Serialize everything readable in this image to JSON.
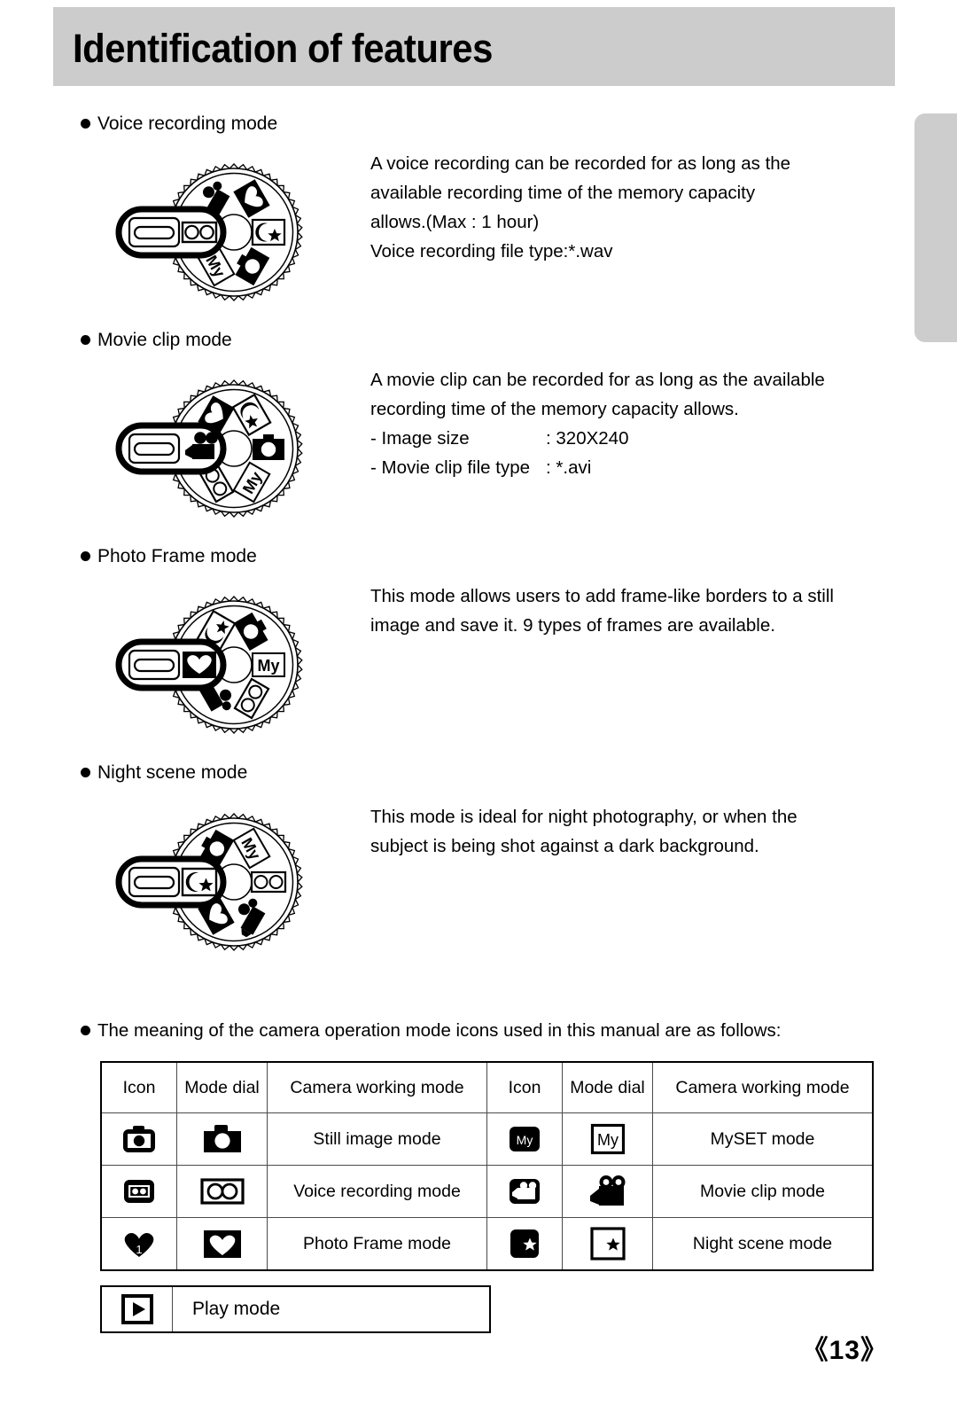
{
  "header": {
    "title": "Identification of features"
  },
  "sections": [
    {
      "heading": "Voice recording mode",
      "body_lines": [
        "A voice recording can be recorded for as long as the",
        "available recording time of the memory capacity",
        "allows.(Max : 1 hour)",
        "Voice recording file type:*.wav"
      ],
      "specs": []
    },
    {
      "heading": "Movie clip mode",
      "body_lines": [
        "A movie clip can be recorded for as long as the available",
        "recording time of the memory capacity allows."
      ],
      "specs": [
        {
          "key": "- Image size",
          "value": ": 320X240"
        },
        {
          "key": "- Movie clip file type",
          "value": ": *.avi"
        }
      ]
    },
    {
      "heading": "Photo Frame mode",
      "body_lines": [
        "This mode allows users to add frame-like borders to a still",
        "image and save it. 9 types of frames are available."
      ],
      "specs": []
    },
    {
      "heading": "Night scene mode",
      "body_lines": [
        "This mode is ideal for night photography, or when the",
        "subject is being shot against a dark background."
      ],
      "specs": []
    }
  ],
  "legend": {
    "intro": "The meaning of the camera operation mode icons used in this manual are as follows:",
    "headers": [
      "Icon",
      "Mode dial",
      "Camera working mode",
      "Icon",
      "Mode dial",
      "Camera working mode"
    ],
    "rows": [
      {
        "left_mode": "Still image mode",
        "right_mode": "MySET mode"
      },
      {
        "left_mode": "Voice recording mode",
        "right_mode": "Movie clip mode"
      },
      {
        "left_mode": "Photo Frame mode",
        "right_mode": "Night scene mode"
      }
    ],
    "play_row": {
      "label": "Play mode"
    },
    "myset_glyph": "My"
  },
  "page_number": "《13》",
  "colors": {
    "header_band": "#cccccc",
    "side_tab": "#cdcdcd",
    "ink": "#000000",
    "table_rule": "#4a4a4a"
  }
}
